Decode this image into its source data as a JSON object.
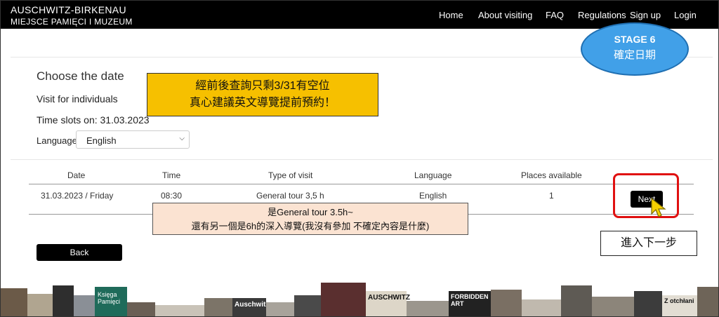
{
  "header": {
    "logo_line1": "AUSCHWITZ-BIRKENAU",
    "logo_line2": "MIEJSCE PAMIĘCI I MUZEUM",
    "nav": [
      "Home",
      "About visiting",
      "FAQ",
      "Regulations",
      "Sign up",
      "Login"
    ]
  },
  "page": {
    "title": "Choose the date",
    "subtitle": "Visit for individuals",
    "time_slots": "Time slots on: 31.03.2023",
    "language_label": "Language:",
    "language_value": "English"
  },
  "table": {
    "headers": [
      "Date",
      "Time",
      "Type of visit",
      "Language",
      "Places available"
    ],
    "row": [
      "31.03.2023 / Friday",
      "08:30",
      "General tour 3,5 h",
      "English",
      "1"
    ],
    "next_label": "Next"
  },
  "back_label": "Back",
  "annotations": {
    "stage_title": "STAGE 6",
    "stage_sub": "確定日期",
    "yellow_note_1": "經前後查詢只剩3/31有空位",
    "yellow_note_2": "真心建議英文導覽提前預約！",
    "peach_note_1": "是General tour 3.5h~",
    "peach_note_2": "還有另一個是6h的深入導覽(我沒有參加 不確定內容是什麼)",
    "next_step": "進入下一步"
  },
  "books": {
    "b1": "Księga Pamięci",
    "b2": "Auschwitz",
    "b3": "AUSCHWITZ",
    "b4": "FORBIDDEN ART",
    "b5": "Z otchłani"
  },
  "colors": {
    "topbar": "#000000",
    "stage_fill": "#41a0e8",
    "yellow_note": "#f6c000",
    "peach_note": "#fbe3d2",
    "highlight": "#e01010"
  }
}
